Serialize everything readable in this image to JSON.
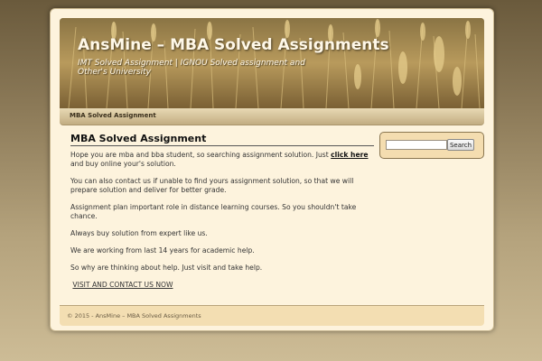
{
  "header": {
    "site_title": "AnsMine – MBA Solved Assignments",
    "tagline": "IMT Solved Assignment | IGNOU Solved assignment and Other's University"
  },
  "nav": {
    "items": [
      {
        "label": "MBA Solved Assignment"
      }
    ]
  },
  "content": {
    "title": "MBA Solved Assignment",
    "p1_before": "Hope you are mba and bba student, so searching assignment solution. Just ",
    "p1_link": "click here",
    "p1_after": " and buy online your's solution.",
    "p2": "You can also contact us if unable to find yours assignment solution, so that we will prepare solution and deliver for better grade.",
    "p3": "Assignment plan important role in distance learning courses. So you shouldn't take chance.",
    "p4": "Always buy solution from expert like us.",
    "p5": "We are working from last 14 years for academic help.",
    "p6": "So why are thinking about help. Just visit and take help.",
    "visit_link": "VISIT AND CONTACT US NOW"
  },
  "sidebar": {
    "search_value": "",
    "search_button": "Search"
  },
  "footer": {
    "text": "© 2015 - AnsMine – MBA Solved Assignments"
  },
  "colors": {
    "accent": "#f4ddb0",
    "page_bg": "#fdf3dd"
  }
}
